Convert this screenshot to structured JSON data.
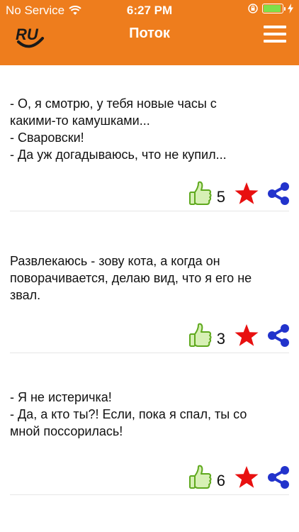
{
  "status_bar": {
    "carrier": "No Service",
    "time": "6:27 PM"
  },
  "header": {
    "logo_text": "RU",
    "title": "Поток"
  },
  "colors": {
    "header_bg": "#ee7d1d",
    "like": "#5fa91e",
    "star": "#e81010",
    "share": "#2233cc"
  },
  "posts": [
    {
      "lines": [
        "- О, я смотрю, у тебя новые часы с",
        "какими-то камушками...",
        "- Сваровски!",
        "- Да уж догадываюсь, что не купил..."
      ],
      "likes": "5"
    },
    {
      "lines": [
        "Развлекаюсь - зову кота, а когда он",
        "поворачивается, делаю вид, что я его не",
        "звал."
      ],
      "likes": "3"
    },
    {
      "lines": [
        "- Я не истеричка!",
        "- Да, а кто ты?! Если, пока я спал, ты со",
        "мной поссорилась!"
      ],
      "likes": "6"
    }
  ]
}
